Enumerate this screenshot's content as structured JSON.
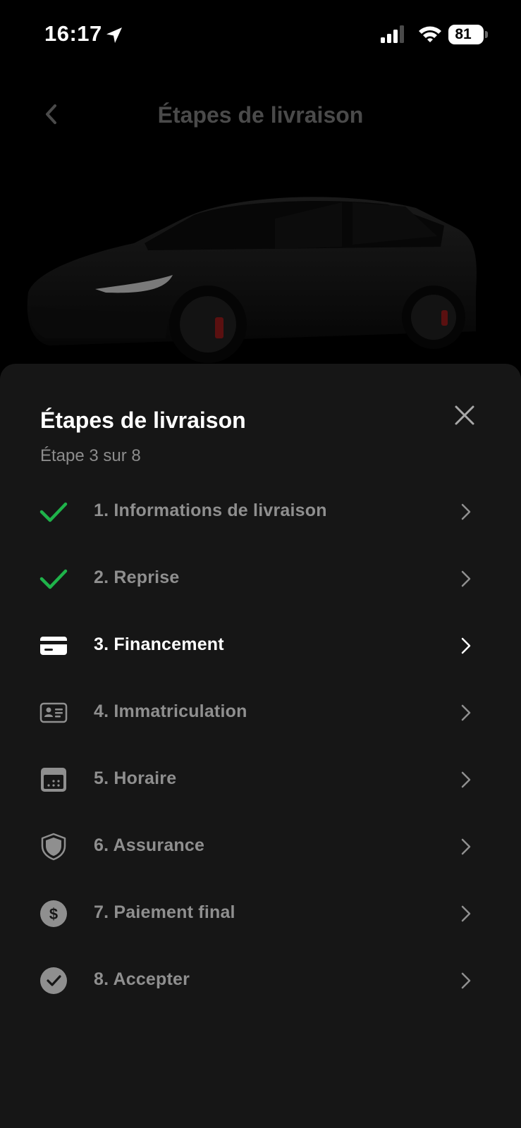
{
  "status_bar": {
    "time": "16:17",
    "battery": "81",
    "icons": [
      "location-arrow-icon",
      "signal-icon",
      "wifi-icon",
      "battery-icon"
    ]
  },
  "header": {
    "title": "Étapes de livraison",
    "back_icon": "chevron-left-icon"
  },
  "sheet": {
    "title": "Étapes de livraison",
    "subtitle": "Étape 3 sur 8",
    "close_icon": "close-icon",
    "steps": [
      {
        "label": "1. Informations de livraison",
        "icon": "check-icon",
        "state": "done"
      },
      {
        "label": "2. Reprise",
        "icon": "check-icon",
        "state": "done"
      },
      {
        "label": "3. Financement",
        "icon": "credit-card-icon",
        "state": "current"
      },
      {
        "label": "4. Immatriculation",
        "icon": "id-card-icon",
        "state": "pending"
      },
      {
        "label": "5. Horaire",
        "icon": "calendar-icon",
        "state": "pending"
      },
      {
        "label": "6. Assurance",
        "icon": "shield-icon",
        "state": "pending"
      },
      {
        "label": "7. Paiement final",
        "icon": "dollar-icon",
        "state": "pending"
      },
      {
        "label": "8. Accepter",
        "icon": "check-circle-icon",
        "state": "pending"
      }
    ]
  },
  "colors": {
    "background": "#000000",
    "sheet": "#161616",
    "check_green": "#1fb34a",
    "muted_text": "#8f8f8f",
    "active_text": "#ffffff",
    "header_title": "#4a4a4a"
  }
}
